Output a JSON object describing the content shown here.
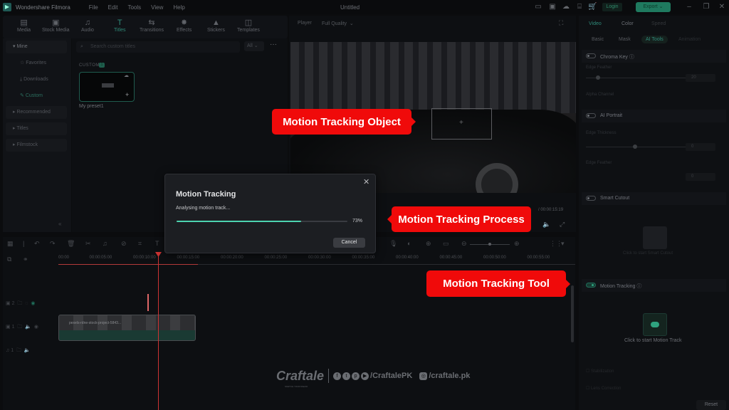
{
  "app": {
    "name": "Wondershare Filmora",
    "menu": [
      "File",
      "Edit",
      "Tools",
      "View",
      "Help"
    ],
    "document_title": "Untitled",
    "login_label": "Login",
    "export_label": "Export"
  },
  "toolbar": {
    "tabs": [
      {
        "label": "Media",
        "icon": "media-icon"
      },
      {
        "label": "Stock Media",
        "icon": "stock-media-icon"
      },
      {
        "label": "Audio",
        "icon": "music-note-icon"
      },
      {
        "label": "Titles",
        "icon": "title-t-icon",
        "active": true
      },
      {
        "label": "Transitions",
        "icon": "transitions-icon"
      },
      {
        "label": "Effects",
        "icon": "effects-sparkle-icon"
      },
      {
        "label": "Stickers",
        "icon": "stickers-icon"
      },
      {
        "label": "Templates",
        "icon": "templates-icon"
      }
    ]
  },
  "sidebar": {
    "items": [
      {
        "label": "Mine",
        "type": "group"
      },
      {
        "label": "Favorites",
        "type": "sub",
        "icon": "star-icon"
      },
      {
        "label": "Downloads",
        "type": "sub",
        "icon": "download-icon"
      },
      {
        "label": "Custom",
        "type": "sub",
        "icon": "brush-icon",
        "active": true
      },
      {
        "label": "Recommended",
        "type": "group"
      },
      {
        "label": "Titles",
        "type": "group"
      },
      {
        "label": "Filmstock",
        "type": "group"
      }
    ]
  },
  "browser": {
    "search_placeholder": "Search custom titles",
    "filter": "All",
    "section_label": "CUSTOM",
    "section_count": "1",
    "preset_name": "My preset1"
  },
  "player": {
    "label": "Player",
    "quality": "Full Quality",
    "duration": "/ 00:00:15:19"
  },
  "timeline": {
    "ruler_ticks": [
      "00:00",
      "00:00:05:00",
      "00:00:10:00",
      "00:00:15:00",
      "00:00:20:00",
      "00:00:25:00",
      "00:00:30:00",
      "00:00:35:00",
      "00:00:40:00",
      "00:00:45:00",
      "00:00:50:00",
      "00:00:55:00"
    ],
    "tracks": [
      {
        "label": "2",
        "type": "video"
      },
      {
        "label": "1",
        "type": "video"
      },
      {
        "label": "1",
        "type": "audio"
      }
    ],
    "clip_label": "pexels-rdne-stock-project-5843..."
  },
  "right_panel": {
    "tabs": [
      {
        "label": "Video",
        "active": true
      },
      {
        "label": "Color"
      },
      {
        "label": "Speed"
      }
    ],
    "subtabs": [
      {
        "label": "Basic"
      },
      {
        "label": "Mask"
      },
      {
        "label": "AI Tools",
        "active": true
      },
      {
        "label": "Animation"
      }
    ],
    "chroma_key": {
      "label": "Chroma Key",
      "enabled": false,
      "edge_feather_label": "Edge Feather",
      "edge_feather_value": "20",
      "alpha_channel_label": "Alpha Channel"
    },
    "ai_portrait": {
      "label": "AI Portrait",
      "enabled": false,
      "edge_thickness_label": "Edge Thickness",
      "edge_thickness_value": "0",
      "edge_feather_label": "Edge Feather",
      "edge_feather_value": "0"
    },
    "smart_cutout": {
      "label": "Smart Cutout",
      "enabled": false,
      "hint": "Click to start Smart Cutout"
    },
    "motion_tracking": {
      "label": "Motion Tracking",
      "enabled": true,
      "hint": "Click to start Motion Track"
    },
    "stabilization_label": "Stabilization",
    "lens_correction_label": "Lens Correction",
    "reset_label": "Reset"
  },
  "dialog": {
    "title": "Motion Tracking",
    "status": "Analysing motion track...",
    "progress_percent": 73,
    "progress_label": "73%",
    "cancel_label": "Cancel"
  },
  "callouts": {
    "object": "Motion Tracking Object",
    "process": "Motion Tracking Process",
    "tool": "Motion Tracking Tool",
    "color": "#f00a0a"
  },
  "watermark": {
    "brand": "Craftale",
    "tagline": "SKETCH YOUR IDEAS!",
    "social_handle": "/CraftalePK",
    "instagram_handle": "/craftale.pk"
  },
  "colors": {
    "accent": "#2fa37f",
    "progress": "#4dd4b0",
    "playhead": "#cc3333"
  }
}
